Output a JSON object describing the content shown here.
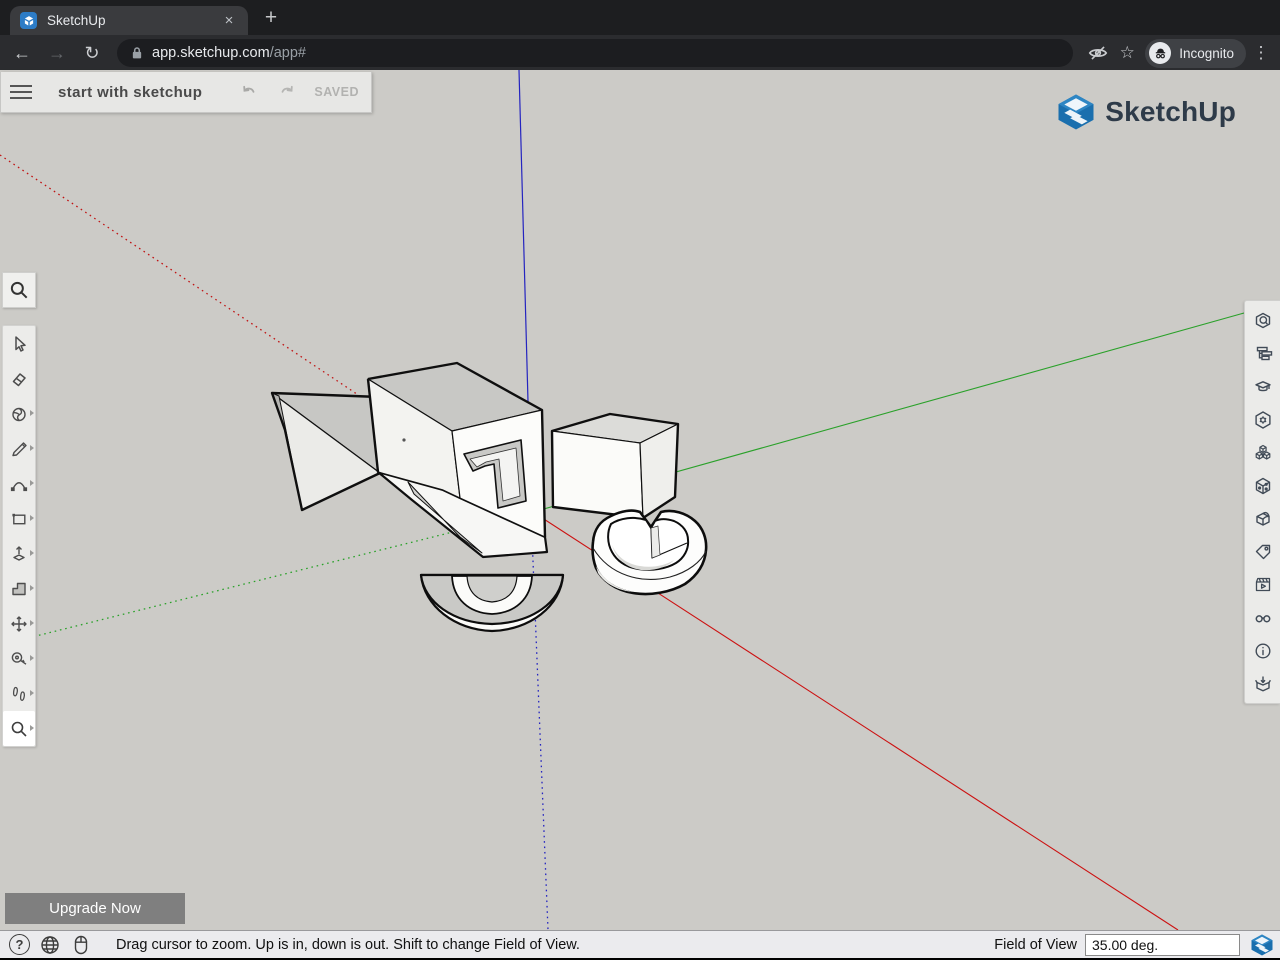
{
  "browser": {
    "tab_title": "SketchUp",
    "new_tab_button": "+",
    "close_tab_button": "×",
    "url_domain": "app.sketchup.com",
    "url_path": "/app#",
    "incognito_label": "Incognito"
  },
  "app_header": {
    "title": "start with sketchup",
    "saved_label": "SAVED"
  },
  "brand": {
    "logo_text": "SketchUp"
  },
  "left_toolbar": {
    "tools": [
      "search",
      "select",
      "eraser",
      "paint",
      "line",
      "arc",
      "rectangle",
      "push-pull",
      "offset",
      "move",
      "tape-measure",
      "walk",
      "zoom"
    ],
    "active_tool": "zoom"
  },
  "right_toolbar": {
    "panels": [
      "entity-info",
      "outliner",
      "instructor",
      "materials",
      "components",
      "styles",
      "soften-edges",
      "tags",
      "scenes",
      "display",
      "model-info",
      "3d-warehouse"
    ]
  },
  "viewport": {
    "background": "#cccbc7",
    "axis_colors": {
      "red": "#c01414",
      "green": "#2aa12a",
      "blue": "#2424c0"
    }
  },
  "upgrade": {
    "label": "Upgrade Now"
  },
  "status_bar": {
    "message": "Drag cursor to zoom. Up is in, down is out. Shift to change Field of View.",
    "field_of_view_label": "Field of View",
    "field_of_view_value": "35.00 deg."
  }
}
